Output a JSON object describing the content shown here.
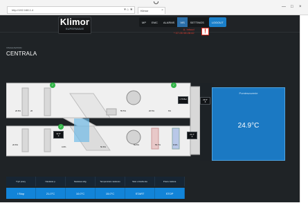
{
  "browser": {
    "address": "http://192.168.1.4",
    "tab_label": "Klimor",
    "address_tools": "▾  ⌂ ★",
    "window_controls": {
      "minimize": "—",
      "restore": "□",
      "close": "×"
    }
  },
  "app": {
    "brand": {
      "name": "Klimor",
      "sub": "SUPERWAVE"
    },
    "nav": [
      {
        "label": "MP",
        "active": false
      },
      {
        "label": "EMC",
        "active": false
      },
      {
        "label": "ALARMS",
        "active": false
      },
      {
        "label": "VIS",
        "active": true
      },
      {
        "label": "SETTINGS",
        "active": false
      },
      {
        "label": "LOGOUT",
        "active": false
      }
    ],
    "alarm": {
      "line1": "A. Infoud",
      "line2": "* 07-05 08:28:42",
      "icon": "warning-icon"
    },
    "section": {
      "small": "VISUALISATION",
      "title": "CENTRALA"
    },
    "temperature": {
      "label": "Pomieszczenie",
      "value": "24.9°C"
    },
    "diagram": {
      "top_values": [
        "26.8%",
        "26",
        "55.5%",
        "26.5%",
        "6%"
      ],
      "bottom_values": [
        "26.8%",
        "0.8%",
        "50.8%",
        "59.8%",
        "55.7%",
        "8.9%"
      ],
      "box_values": [
        {
          "line1": "1.76 Bar",
          "line2": ""
        },
        {
          "line1": "29.9°",
          "line2": "8"
        },
        {
          "line1": "32.6°",
          "line2": "0"
        },
        {
          "line1": "21.4°",
          "line2": "0"
        }
      ],
      "status_icons": [
        {
          "name": "status-ok-icon-1",
          "glyph": "✓"
        },
        {
          "name": "status-ok-icon-2",
          "glyph": "✓"
        },
        {
          "name": "status-ok-icon-3",
          "glyph": "✓"
        }
      ]
    },
    "controls": {
      "headers": [
        "Tryb pracy",
        "Nastawa p.",
        "Nastawa wilg.",
        "Temperatura nawiewu",
        "Stan urzadzenia",
        "Praca zadana"
      ],
      "values": [
        "I Stop",
        "21.0°C",
        "10.0°C",
        "15.0°C",
        "START",
        "STOP"
      ]
    },
    "colors": {
      "bg": "#1f2326",
      "accent": "#1284d8",
      "temp_panel": "#1b79c3",
      "alarm": "#e02a1e"
    }
  }
}
